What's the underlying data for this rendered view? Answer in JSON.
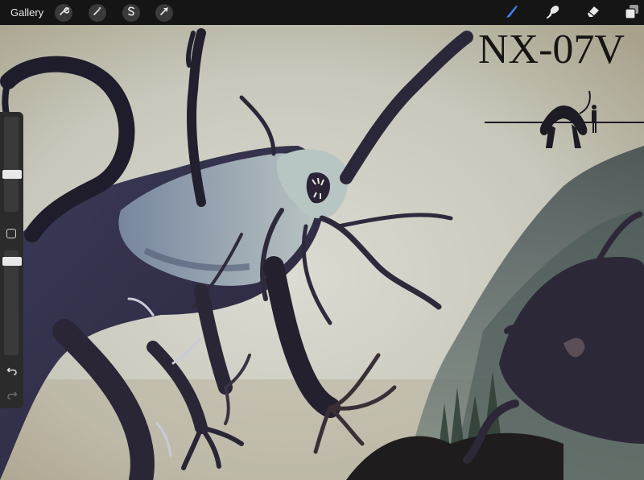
{
  "topbar": {
    "gallery_label": "Gallery",
    "left_tools": [
      "wrench-icon",
      "magic-wand-icon",
      "selection-s-icon",
      "transform-arrow-icon"
    ],
    "right_tools": [
      "brush-icon",
      "smudge-icon",
      "eraser-icon",
      "layers-icon"
    ],
    "active_tool": "brush-icon",
    "active_color": "#3b82f6"
  },
  "sidebar": {
    "brush_size_level": 0.38,
    "opacity_level": 0.28
  },
  "canvas": {
    "title_text": "NX-07V"
  }
}
